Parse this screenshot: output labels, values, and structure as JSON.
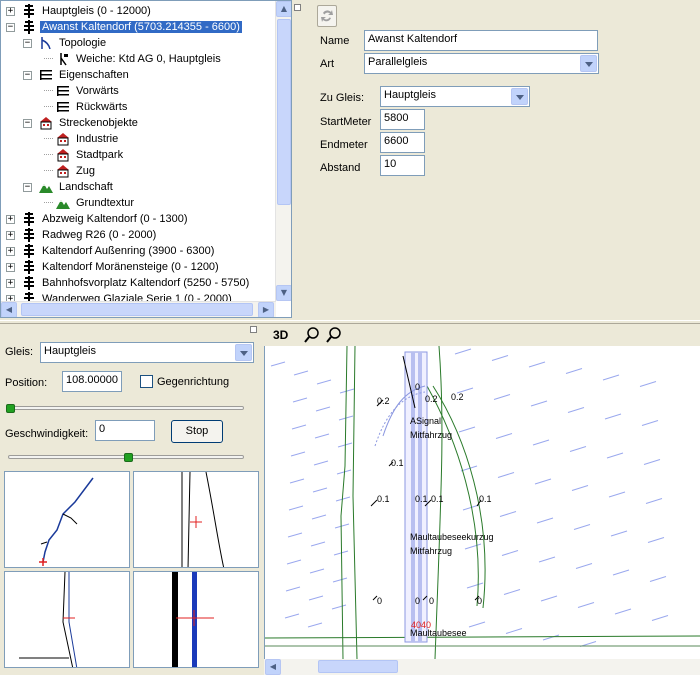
{
  "tree": {
    "items": [
      {
        "label": "Hauptgleis (0 - 12000)",
        "icon": "track-icon",
        "expander": "+"
      },
      {
        "label": "Awanst Kaltendorf (5703.214355 - 6600)",
        "icon": "track-icon",
        "expander": "−"
      },
      {
        "label": "Topologie",
        "icon": "topology-icon",
        "expander": "−"
      },
      {
        "label": "Weiche: Ktd AG 0, Hauptgleis",
        "icon": "switch-icon",
        "expander": ""
      },
      {
        "label": "Eigenschaften",
        "icon": "list-icon",
        "expander": "−"
      },
      {
        "label": "Vorwärts",
        "icon": "list-icon",
        "expander": ""
      },
      {
        "label": "Rückwärts",
        "icon": "list-icon",
        "expander": ""
      },
      {
        "label": "Streckenobjekte",
        "icon": "building-icon",
        "expander": "−"
      },
      {
        "label": "Industrie",
        "icon": "building-icon",
        "expander": ""
      },
      {
        "label": "Stadtpark",
        "icon": "building-icon",
        "expander": ""
      },
      {
        "label": "Zug",
        "icon": "building-icon",
        "expander": ""
      },
      {
        "label": "Landschaft",
        "icon": "landscape-icon",
        "expander": "−"
      },
      {
        "label": "Grundtextur",
        "icon": "landscape-icon",
        "expander": ""
      },
      {
        "label": "Abzweig Kaltendorf (0 - 1300)",
        "icon": "track-icon",
        "expander": "+"
      },
      {
        "label": "Radweg R26 (0 - 2000)",
        "icon": "track-icon",
        "expander": "+"
      },
      {
        "label": "Kaltendorf Außenring (3900 - 6300)",
        "icon": "track-icon",
        "expander": "+"
      },
      {
        "label": "Kaltendorf Moränensteige (0 - 1200)",
        "icon": "track-icon",
        "expander": "+"
      },
      {
        "label": "Bahnhofsvorplatz Kaltendorf (5250 - 5750)",
        "icon": "track-icon",
        "expander": "+"
      },
      {
        "label": "Wanderweg Glaziale Serie 1 (0 - 2000)",
        "icon": "track-icon",
        "expander": "+"
      }
    ]
  },
  "props": {
    "name_label": "Name",
    "name_value": "Awanst Kaltendorf",
    "art_label": "Art",
    "art_value": "Parallelgleis",
    "zugleis_label": "Zu Gleis:",
    "zugleis_value": "Hauptgleis",
    "startmeter_label": "StartMeter",
    "startmeter_value": "5800",
    "endmeter_label": "Endmeter",
    "endmeter_value": "6600",
    "abstand_label": "Abstand",
    "abstand_value": "10"
  },
  "control": {
    "gleis_label": "Gleis:",
    "gleis_value": "Hauptgleis",
    "position_label": "Position:",
    "position_value": "108.00000",
    "gegenrichtung_label": "Gegenrichtung",
    "gegenrichtung_checked": false,
    "speed_label": "Geschwindigkeit:",
    "speed_value": "0",
    "stop_label": "Stop"
  },
  "maptoolbar": {
    "mode_label": "3D",
    "zoom_in_icon": "zoom-in-icon",
    "zoom_out_icon": "zoom-out-icon"
  },
  "map": {
    "labels": [
      {
        "text": "0.2"
      },
      {
        "text": "0"
      },
      {
        "text": "0.2"
      },
      {
        "text": "0.2"
      },
      {
        "text": "ASignal"
      },
      {
        "text": "Mitfahrzug"
      },
      {
        "text": "0.1"
      },
      {
        "text": "0.1"
      },
      {
        "text": "0.1"
      },
      {
        "text": "0.1"
      },
      {
        "text": "0.1"
      },
      {
        "text": "Maultaubeseekurzug"
      },
      {
        "text": "Mitfahrzug"
      },
      {
        "text": "0"
      },
      {
        "text": "0"
      },
      {
        "text": "0"
      },
      {
        "text": "0"
      },
      {
        "text": "4040"
      },
      {
        "text": "Maultaubesee"
      }
    ]
  },
  "colors": {
    "selection": "#316ac5",
    "track_green": "#2a7a2a",
    "track_blue": "#1a3a9a",
    "cursor_red": "#e02020"
  }
}
